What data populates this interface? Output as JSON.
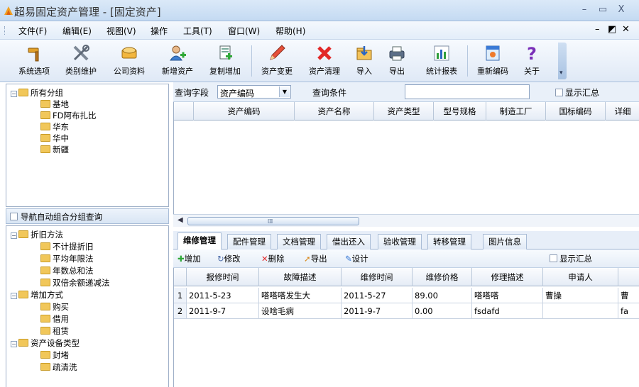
{
  "window": {
    "title": "超易固定资产管理 - [固定资产]",
    "controls": {
      "minimize": "–",
      "maximize": "▭",
      "close": "X"
    },
    "mdi_controls": {
      "minimize": "–",
      "restore": "◩",
      "close": "✕"
    }
  },
  "menu": [
    "文件(F)",
    "编辑(E)",
    "视图(V)",
    "操作",
    "工具(T)",
    "窗口(W)",
    "帮助(H)"
  ],
  "toolbar": [
    {
      "label": "系统选项",
      "icon": "hammer-icon"
    },
    {
      "label": "类别维护",
      "icon": "tools-icon"
    },
    {
      "label": "公司资料",
      "icon": "building-icon"
    },
    {
      "label": "新增资产",
      "icon": "add-user-icon"
    },
    {
      "label": "复制增加",
      "icon": "copy-add-icon"
    },
    {
      "label": "资产变更",
      "icon": "pencil-icon"
    },
    {
      "label": "资产清理",
      "icon": "delete-x-icon"
    },
    {
      "label": "导入",
      "icon": "import-icon"
    },
    {
      "label": "导出",
      "icon": "printer-export-icon"
    },
    {
      "label": "统计报表",
      "icon": "chart-icon"
    },
    {
      "label": "重新编码",
      "icon": "recode-icon"
    },
    {
      "label": "关于",
      "icon": "question-icon"
    }
  ],
  "group_tree": {
    "root": "所有分组",
    "children": [
      "基地",
      "FD阿布扎比",
      "华东",
      "华中",
      "新疆"
    ]
  },
  "nav_option": "导航自动组合分组查询",
  "nav_tree": [
    {
      "label": "折旧方法",
      "children": [
        "不计提折旧",
        "平均年限法",
        "年数总和法",
        "双倍余额递减法"
      ]
    },
    {
      "label": "增加方式",
      "children": [
        "购买",
        "借用",
        "租赁"
      ]
    },
    {
      "label": "资产设备类型",
      "children": [
        "封堵",
        "疏清洗"
      ]
    }
  ],
  "query": {
    "field_label": "查询字段",
    "field_value": "资产编码",
    "condition_label": "查询条件",
    "condition_value": "",
    "summary_label": "显示汇总"
  },
  "asset_grid": {
    "columns": [
      "资产编码",
      "资产名称",
      "资产类型",
      "型号规格",
      "制造工厂",
      "国标编码",
      "详细"
    ]
  },
  "tabs": [
    "维修管理",
    "配件管理",
    "文档管理",
    "借出还入",
    "验收管理",
    "转移管理",
    "图片信息"
  ],
  "active_tab": "维修管理",
  "sub_toolbar": {
    "add": "增加",
    "edit": "修改",
    "delete": "删除",
    "export": "导出",
    "design": "设计",
    "summary": "显示汇总"
  },
  "repair_grid": {
    "columns": [
      "报修时间",
      "故障描述",
      "维修时间",
      "维修价格",
      "修理描述",
      "申请人",
      ""
    ],
    "rows": [
      {
        "no": "1",
        "cells": [
          "2011-5-23",
          "嗒嗒嗒发生大",
          "2011-5-27",
          "89.00",
          "嗒嗒嗒",
          "曹操",
          "曹"
        ]
      },
      {
        "no": "2",
        "cells": [
          "2011-9-7",
          "设啥毛病",
          "2011-9-7",
          "0.00",
          "fsdafd",
          "",
          "fa"
        ]
      }
    ]
  }
}
